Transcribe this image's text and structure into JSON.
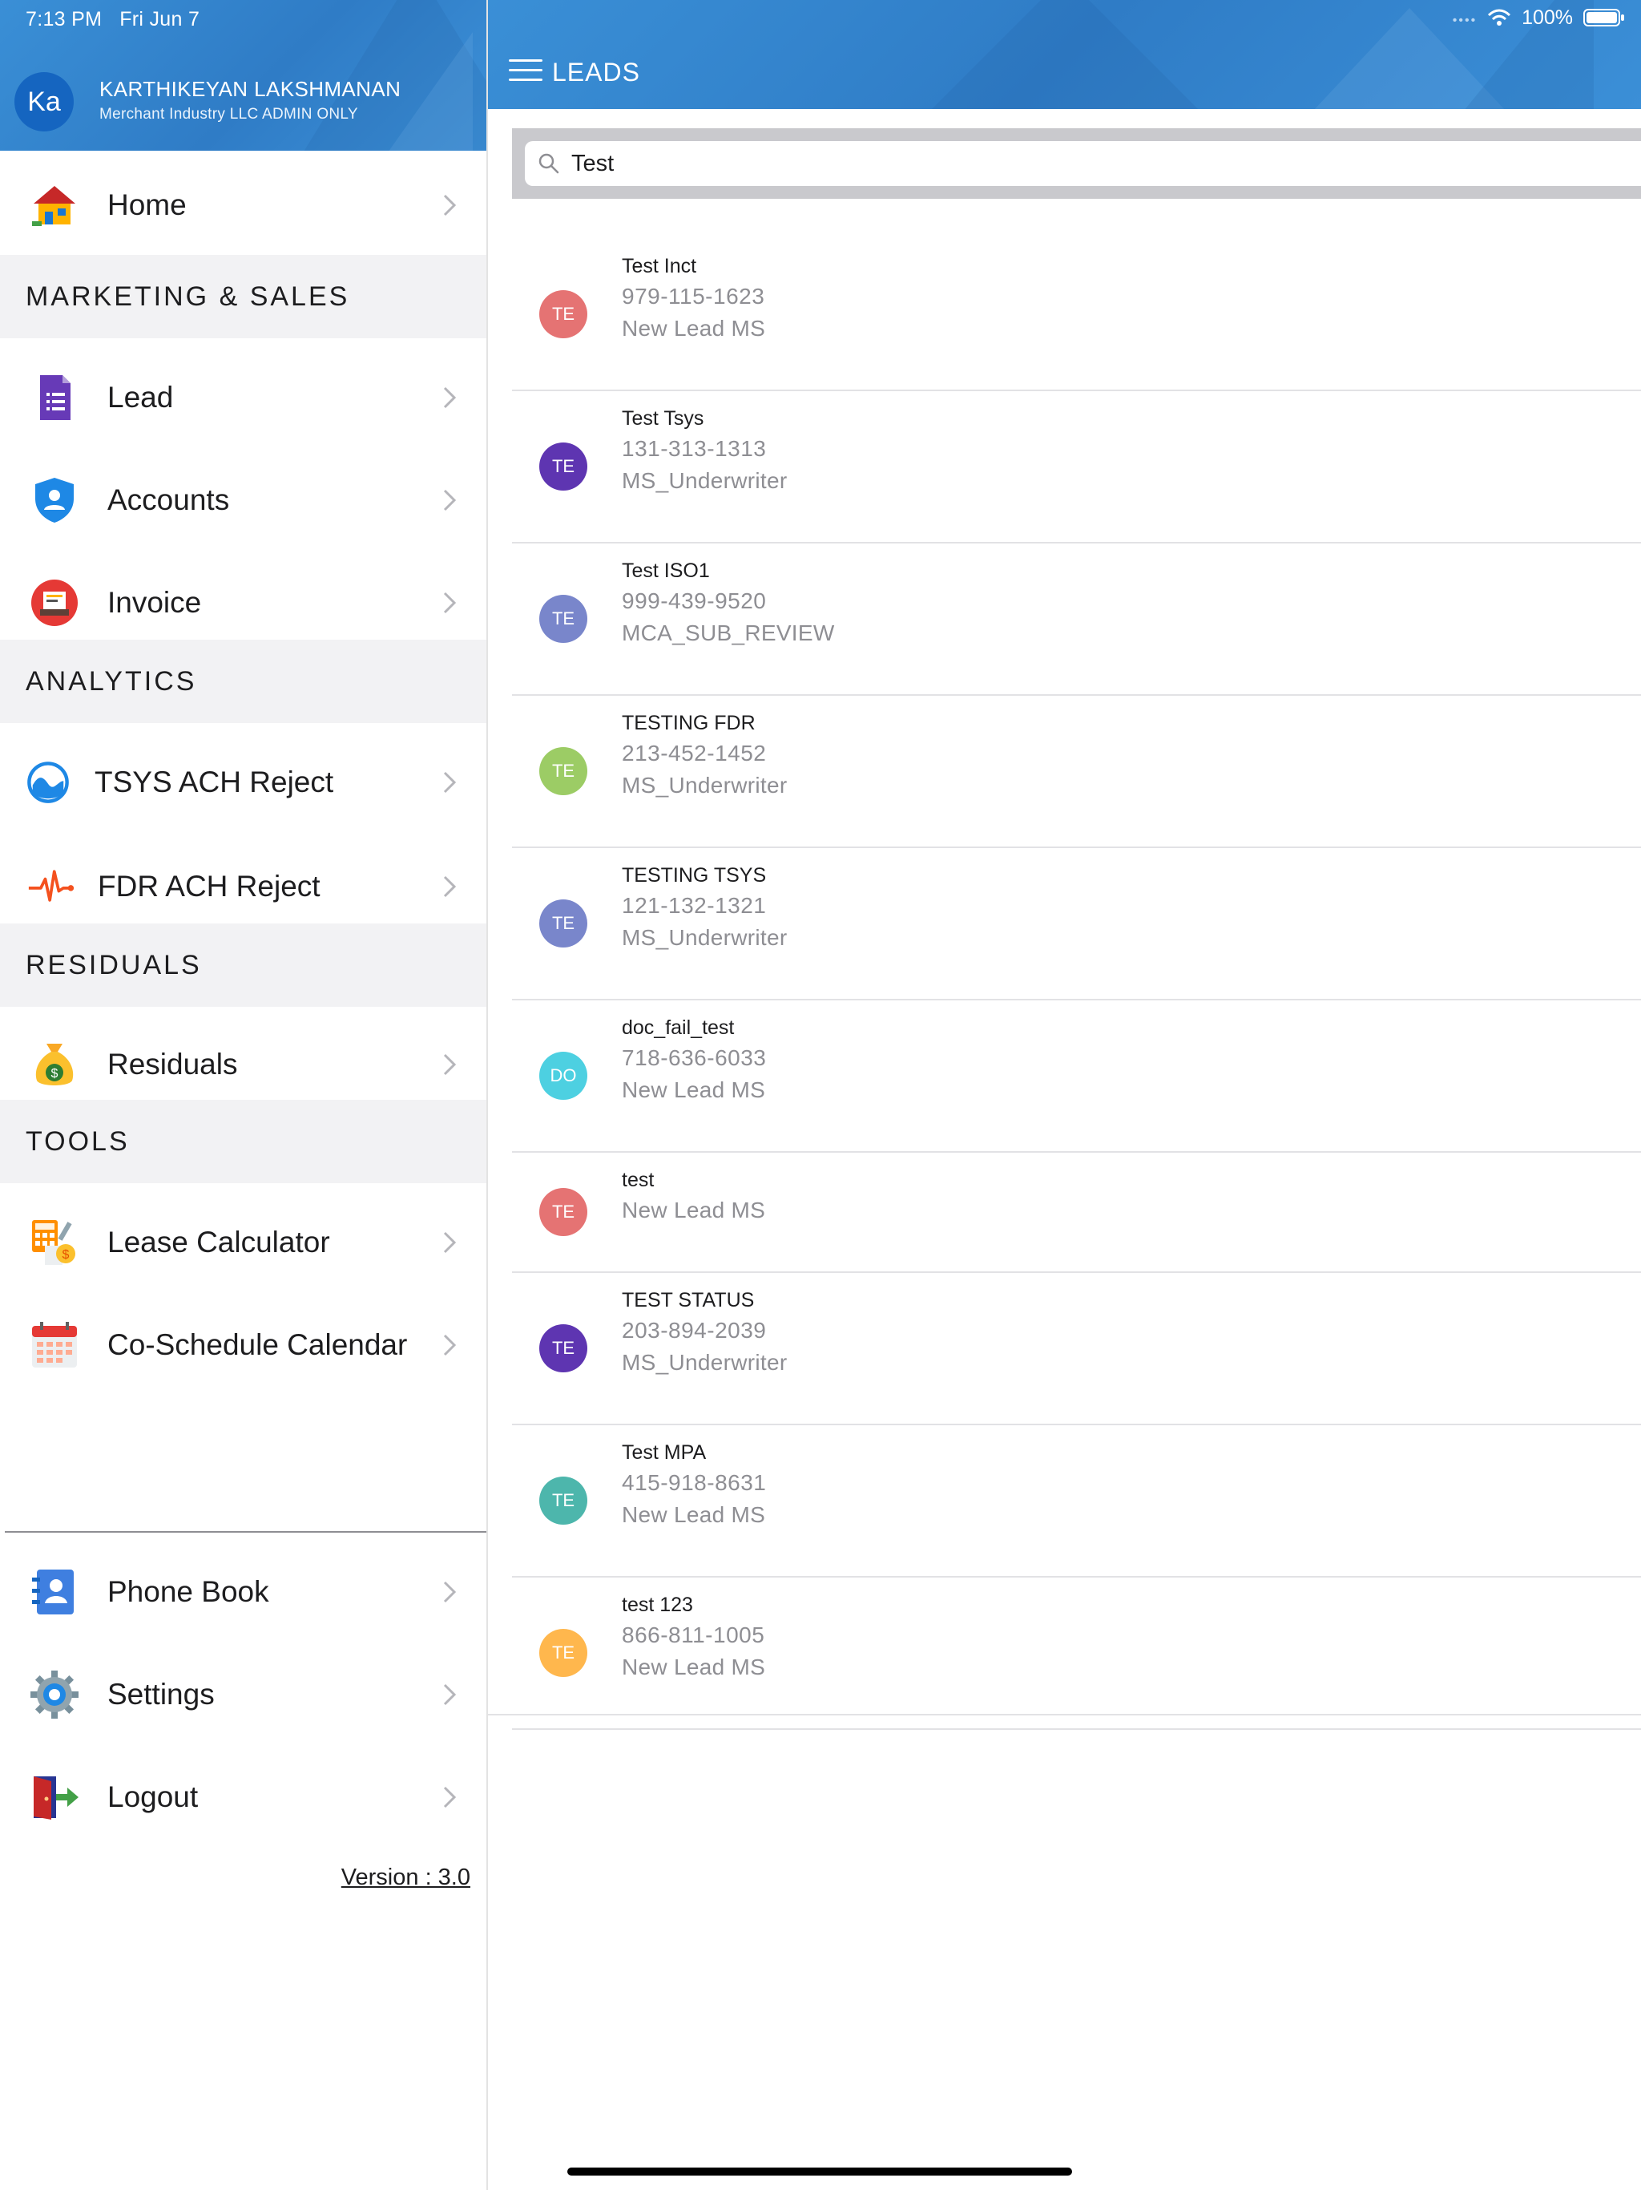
{
  "status_bar": {
    "time": "7:13 PM",
    "date": "Fri Jun 7",
    "battery": "100%"
  },
  "user": {
    "initials": "Ka",
    "name": "KARTHIKEYAN LAKSHMANAN",
    "org": "Merchant Industry LLC ADMIN ONLY"
  },
  "sidebar": {
    "home": {
      "label": "Home",
      "icon": "house-icon"
    },
    "sections": {
      "marketing": "MARKETING & SALES",
      "analytics": "ANALYTICS",
      "residuals": "RESIDUALS",
      "tools": "TOOLS"
    },
    "items": {
      "lead": {
        "label": "Lead",
        "icon": "form-icon"
      },
      "accounts": {
        "label": "Accounts",
        "icon": "shield-user-icon"
      },
      "invoice": {
        "label": "Invoice",
        "icon": "invoice-icon"
      },
      "tsys": {
        "label": "TSYS ACH Reject",
        "icon": "wave-icon"
      },
      "fdr": {
        "label": "FDR ACH Reject",
        "icon": "pulse-icon"
      },
      "residuals": {
        "label": "Residuals",
        "icon": "money-bag-icon"
      },
      "lease": {
        "label": "Lease Calculator",
        "icon": "calculator-icon"
      },
      "calendar": {
        "label": "Co-Schedule Calendar",
        "icon": "calendar-icon"
      },
      "phonebook": {
        "label": "Phone Book",
        "icon": "contacts-icon"
      },
      "settings": {
        "label": "Settings",
        "icon": "gear-icon"
      },
      "logout": {
        "label": "Logout",
        "icon": "exit-door-icon"
      }
    },
    "version": "Version : 3.0"
  },
  "header": {
    "title": "LEADS"
  },
  "search": {
    "value": "Test",
    "placeholder": ""
  },
  "leads": [
    {
      "initials": "TE",
      "name": "Test Inct",
      "phone": "979-115-1623",
      "status": "New Lead MS",
      "color": "#e57373"
    },
    {
      "initials": "TE",
      "name": "Test Tsys",
      "phone": "131-313-1313",
      "status": "MS_Underwriter",
      "color": "#5e35b1"
    },
    {
      "initials": "TE",
      "name": "Test ISO1",
      "phone": "999-439-9520",
      "status": "MCA_SUB_REVIEW",
      "color": "#7986cb"
    },
    {
      "initials": "TE",
      "name": "TESTING FDR",
      "phone": "213-452-1452",
      "status": "MS_Underwriter",
      "color": "#9ccc65"
    },
    {
      "initials": "TE",
      "name": "TESTING TSYS",
      "phone": "121-132-1321",
      "status": "MS_Underwriter",
      "color": "#7986cb"
    },
    {
      "initials": "DO",
      "name": "doc_fail_test",
      "phone": "718-636-6033",
      "status": "New Lead MS",
      "color": "#4dd0e1"
    },
    {
      "initials": "TE",
      "name": "test",
      "phone": "",
      "status": "New Lead MS",
      "color": "#e57373"
    },
    {
      "initials": "TE",
      "name": "TEST STATUS",
      "phone": "203-894-2039",
      "status": "MS_Underwriter",
      "color": "#5e35b1"
    },
    {
      "initials": "TE",
      "name": "Test MPA",
      "phone": "415-918-8631",
      "status": "New Lead MS",
      "color": "#4db6ac"
    },
    {
      "initials": "TE",
      "name": "test 123",
      "phone": "866-811-1005",
      "status": "New Lead MS",
      "color": "#ffb74d"
    }
  ]
}
